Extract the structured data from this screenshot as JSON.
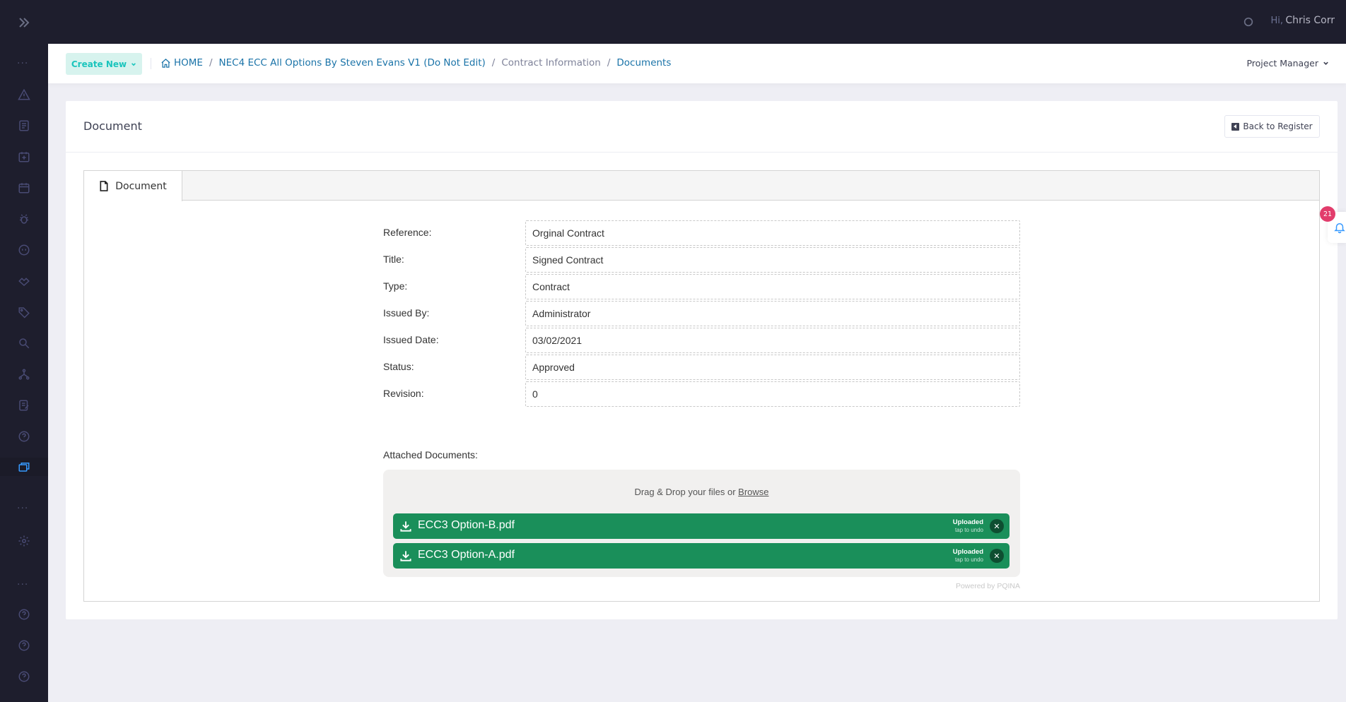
{
  "topbar": {
    "greeting": "Hi,",
    "user_name": "Chris Corr"
  },
  "sidebar": {
    "icons": [
      "chevrons-right-icon",
      "alert-icon",
      "list-icon",
      "calendar-plus-icon",
      "calendar-31-icon",
      "bug-icon",
      "quote-icon",
      "handshake-icon",
      "tag-icon",
      "search-icon",
      "sitemap-icon",
      "signature-icon",
      "help-icon",
      "documents-icon",
      "settings-icon",
      "help-icon",
      "help-icon",
      "help-icon"
    ],
    "active_item": "documents-icon"
  },
  "subheader": {
    "create_new_label": "Create New",
    "breadcrumb": {
      "home": "HOME",
      "project": "NEC4 ECC All Options By Steven Evans V1 (Do Not Edit)",
      "section": "Contract Information",
      "page": "Documents"
    },
    "role": "Project Manager"
  },
  "card": {
    "title": "Document",
    "back_label": "Back to Register",
    "tab_label": "Document"
  },
  "form": {
    "fields": [
      {
        "label": "Reference:",
        "value": "Orginal Contract"
      },
      {
        "label": "Title:",
        "value": "Signed Contract"
      },
      {
        "label": "Type:",
        "value": "Contract"
      },
      {
        "label": "Issued By:",
        "value": "Administrator"
      },
      {
        "label": "Issued Date:",
        "value": "03/02/2021"
      },
      {
        "label": "Status:",
        "value": "Approved"
      },
      {
        "label": "Revision:",
        "value": "0"
      }
    ],
    "attached_label": "Attached Documents:"
  },
  "dropzone": {
    "text": "Drag & Drop your files or",
    "browse": "Browse",
    "files": [
      {
        "name": "ECC3 Option-B.pdf",
        "status": "Uploaded",
        "hint": "tap to undo"
      },
      {
        "name": "ECC3 Option-A.pdf",
        "status": "Uploaded",
        "hint": "tap to undo"
      }
    ],
    "powered_by": "Powered by PQINA"
  },
  "notifications": {
    "count": "21"
  },
  "colors": {
    "dark": "#1e1e2d",
    "accent": "#1a73a8",
    "success": "#1a8f5a",
    "badge": "#e23d6c"
  }
}
